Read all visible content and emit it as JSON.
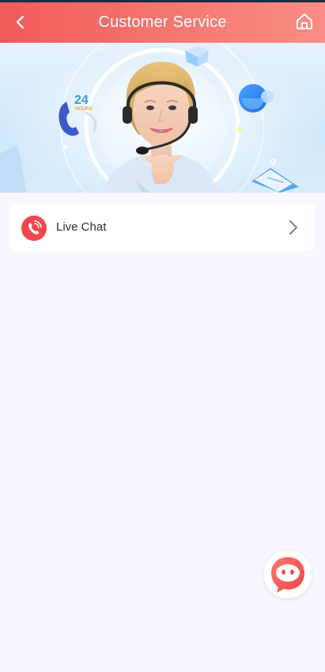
{
  "header": {
    "title": "Customer Service",
    "back_icon": "chevron-left-icon",
    "home_icon": "home-icon"
  },
  "banner": {
    "badge_number": "24",
    "badge_text": "HOURS"
  },
  "service_list": [
    {
      "label": "Live Chat",
      "icon": "phone-icon",
      "action_icon": "chevron-right-icon"
    }
  ],
  "fab": {
    "icon": "chat-bubble-icon"
  },
  "colors": {
    "header_start": "#f05a5a",
    "header_end": "#fb8c86",
    "accent": "#f0474c",
    "page_bg": "#f6f7ff"
  }
}
